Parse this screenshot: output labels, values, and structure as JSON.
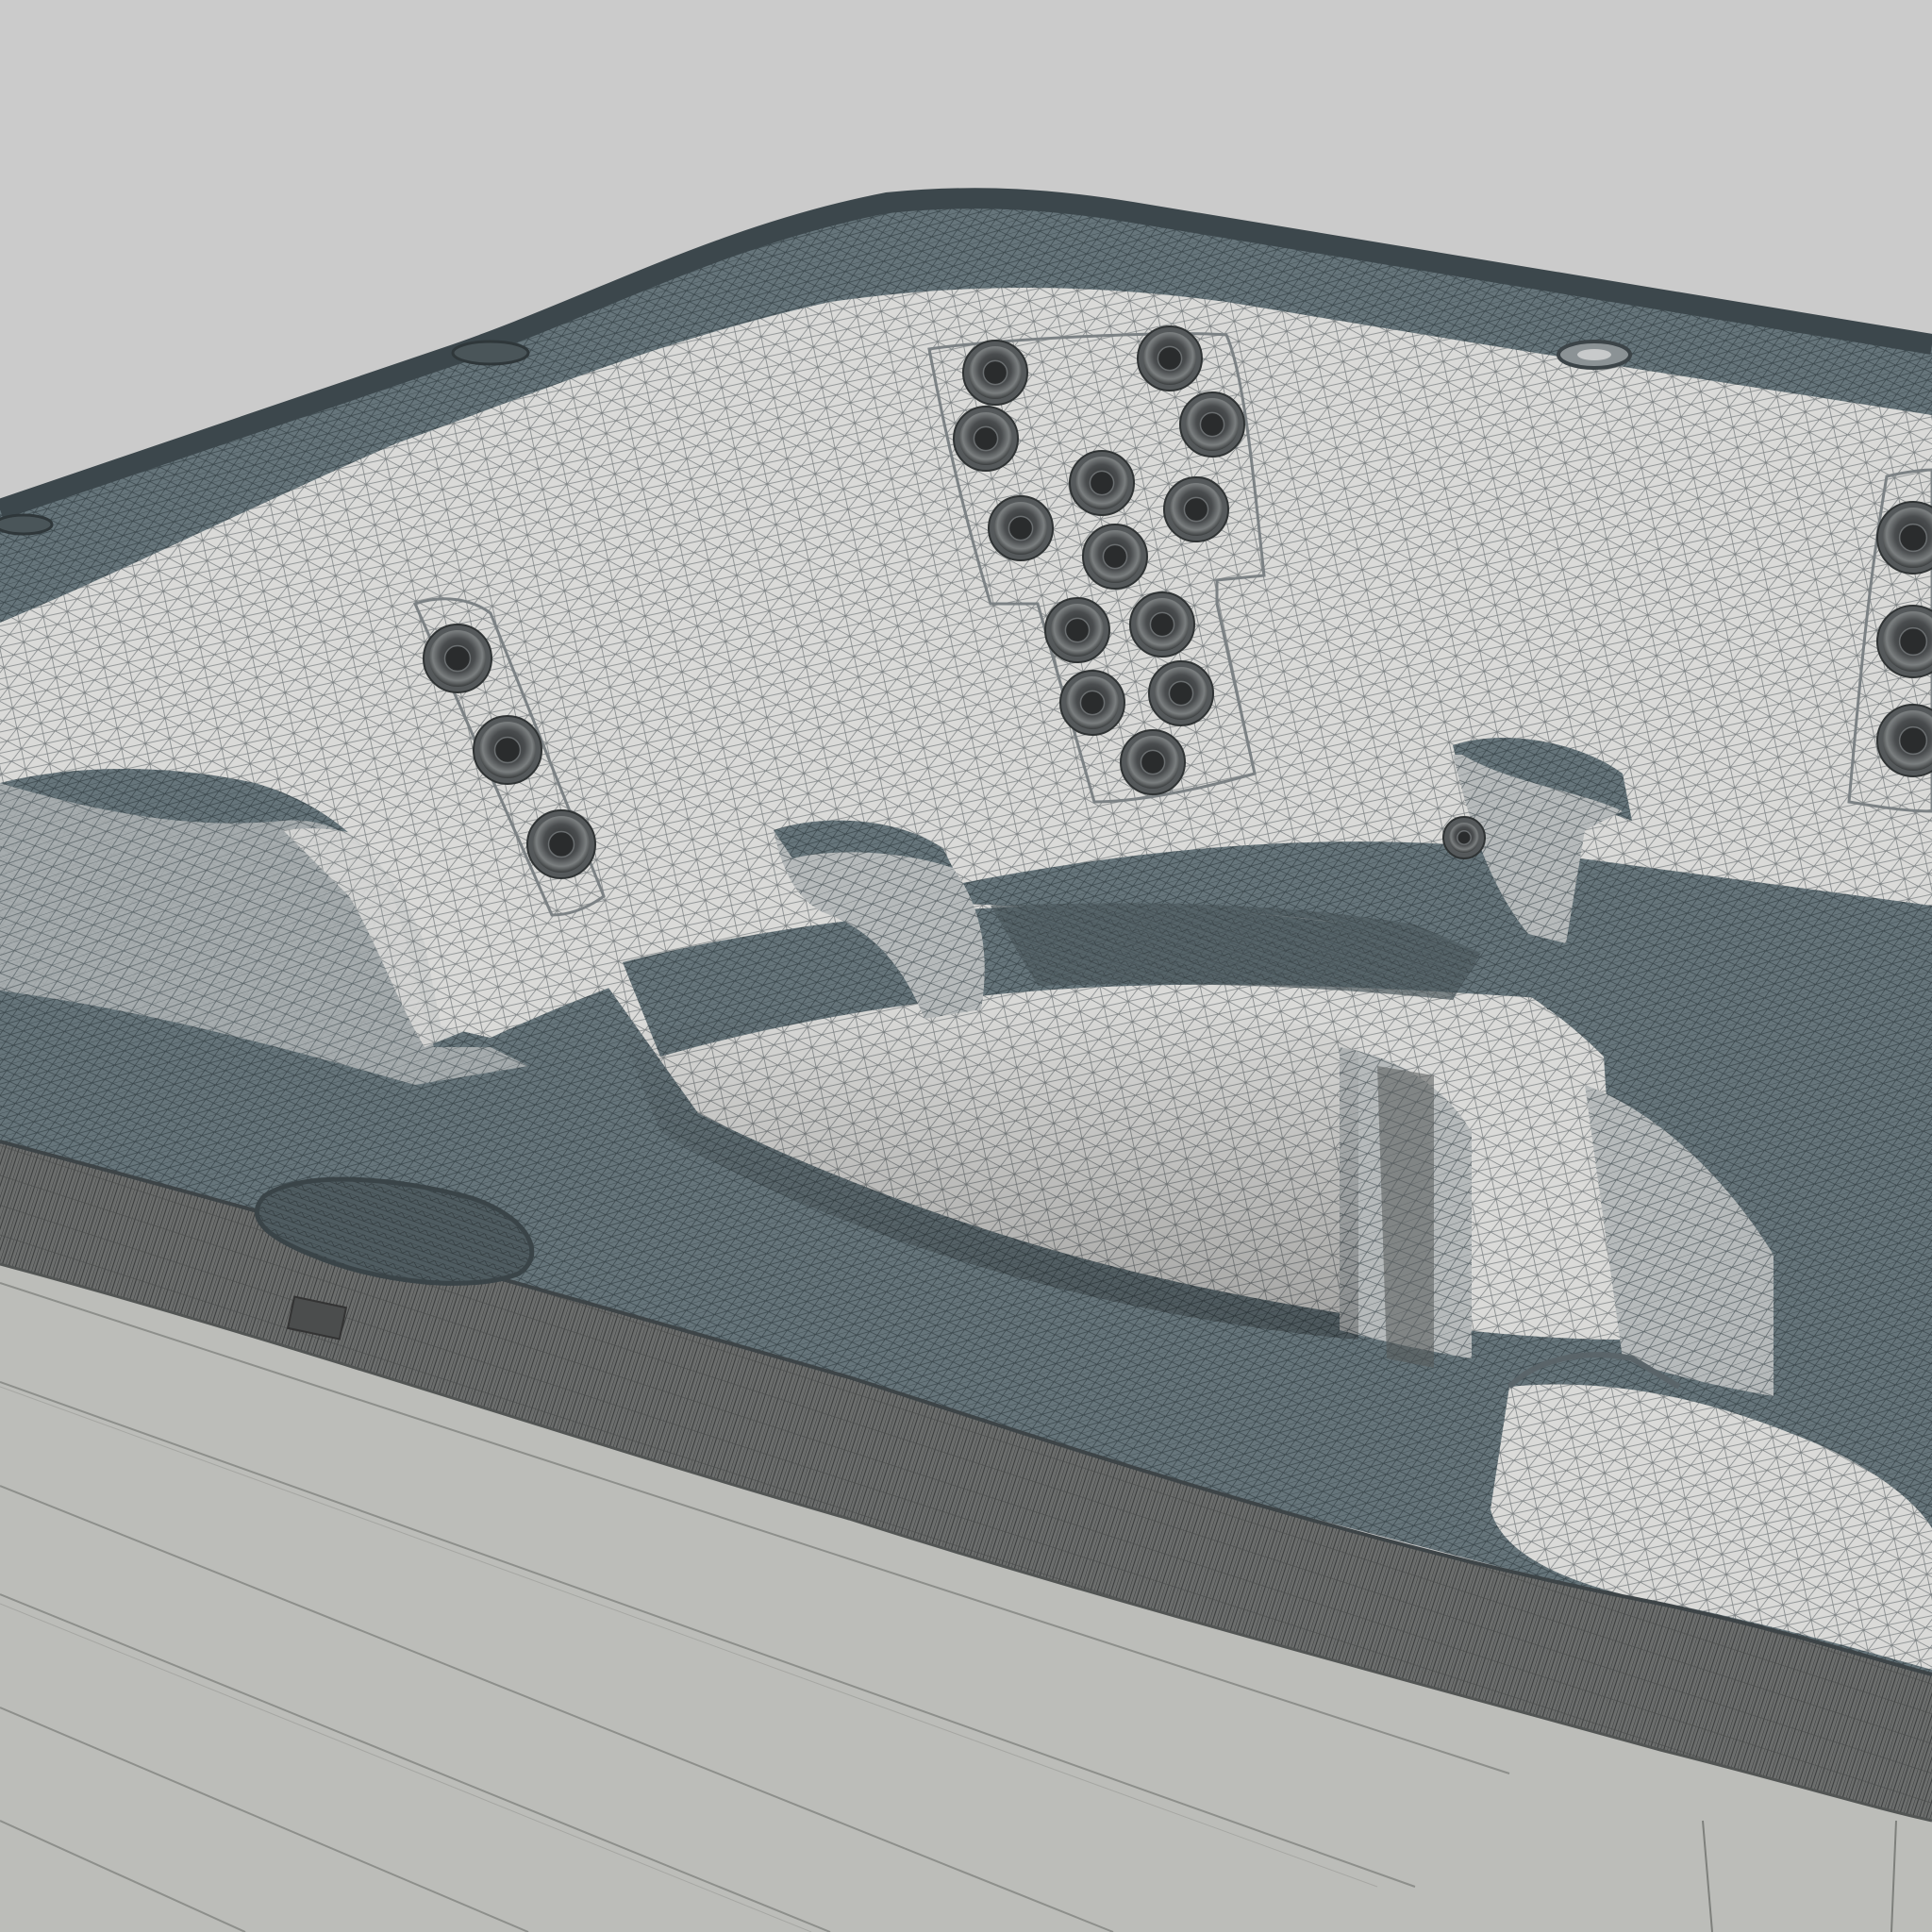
{
  "scene": {
    "subject": "hot-tub-wireframe",
    "colors": {
      "background": "#cbcbcb",
      "shell_white": "#d9d9d7",
      "shell_shadow": "#a9adad",
      "rim_slate": "#5e6c72",
      "rim_dark": "#3f4a4f",
      "cabinet": "#b9bab6",
      "cabinet_line": "#8f908c",
      "jet_dark": "#3a3d3e",
      "jet_ring": "#6d7072",
      "wire": "#3b4245"
    }
  }
}
